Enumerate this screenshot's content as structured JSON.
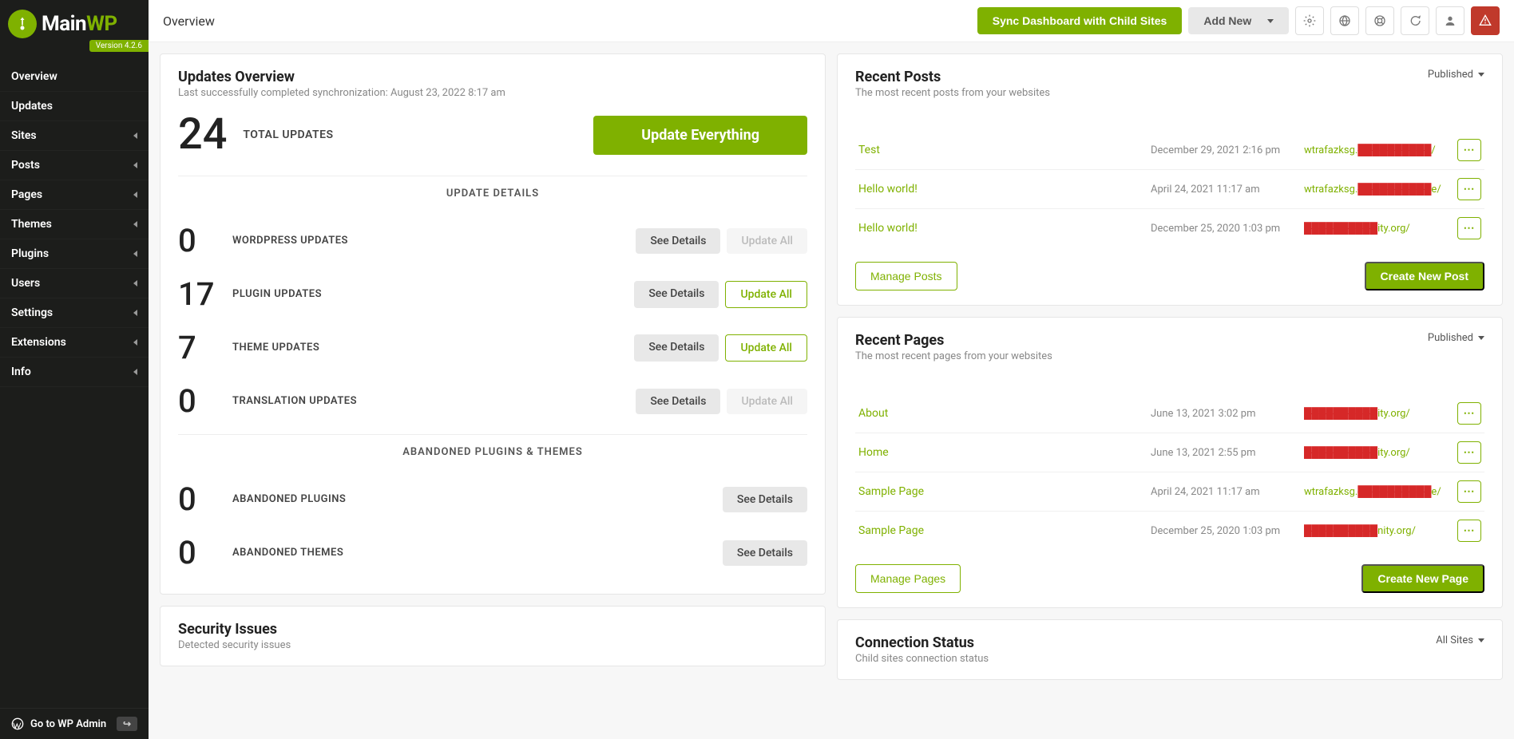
{
  "brand": {
    "name1": "Main",
    "name2": "WP",
    "version": "Version 4.2.6"
  },
  "sidebar": {
    "items": [
      {
        "label": "Overview",
        "caret": false
      },
      {
        "label": "Updates",
        "caret": false
      },
      {
        "label": "Sites",
        "caret": true
      },
      {
        "label": "Posts",
        "caret": true
      },
      {
        "label": "Pages",
        "caret": true
      },
      {
        "label": "Themes",
        "caret": true
      },
      {
        "label": "Plugins",
        "caret": true
      },
      {
        "label": "Users",
        "caret": true
      },
      {
        "label": "Settings",
        "caret": true
      },
      {
        "label": "Extensions",
        "caret": true
      },
      {
        "label": "Info",
        "caret": true
      }
    ],
    "footer": "Go to WP Admin"
  },
  "topbar": {
    "title": "Overview",
    "sync": "Sync Dashboard with Child Sites",
    "addnew": "Add New"
  },
  "updates": {
    "title": "Updates Overview",
    "sub": "Last successfully completed synchronization: August 23, 2022 8:17 am",
    "total_num": "24",
    "total_label": "TOTAL UPDATES",
    "update_everything": "Update Everything",
    "section1": "UPDATE DETAILS",
    "section2": "ABANDONED PLUGINS & THEMES",
    "see_details": "See Details",
    "update_all": "Update All",
    "rows": [
      {
        "num": "0",
        "label": "WORDPRESS UPDATES",
        "update_enabled": false
      },
      {
        "num": "17",
        "label": "PLUGIN UPDATES",
        "update_enabled": true
      },
      {
        "num": "7",
        "label": "THEME UPDATES",
        "update_enabled": true
      },
      {
        "num": "0",
        "label": "TRANSLATION UPDATES",
        "update_enabled": false
      }
    ],
    "abandoned": [
      {
        "num": "0",
        "label": "ABANDONED PLUGINS"
      },
      {
        "num": "0",
        "label": "ABANDONED THEMES"
      }
    ]
  },
  "security": {
    "title": "Security Issues",
    "sub": "Detected security issues"
  },
  "posts": {
    "title": "Recent Posts",
    "sub": "The most recent posts from your websites",
    "filter": "Published",
    "manage": "Manage Posts",
    "create": "Create New Post",
    "items": [
      {
        "title": "Test",
        "date": "December 29, 2021 2:16 pm",
        "site_pre": "wtrafazksg.",
        "site_red": "██████████",
        "site_suf": "/"
      },
      {
        "title": "Hello world!",
        "date": "April 24, 2021 11:17 am",
        "site_pre": "wtrafazksg.",
        "site_red": "██████████",
        "site_suf": "e/"
      },
      {
        "title": "Hello world!",
        "date": "December 25, 2020 1:03 pm",
        "site_pre": "",
        "site_red": "██████████",
        "site_suf": "ity.org/"
      }
    ]
  },
  "pages": {
    "title": "Recent Pages",
    "sub": "The most recent pages from your websites",
    "filter": "Published",
    "manage": "Manage Pages",
    "create": "Create New Page",
    "items": [
      {
        "title": "About",
        "date": "June 13, 2021 3:02 pm",
        "site_pre": "",
        "site_red": "██████████",
        "site_suf": "ity.org/"
      },
      {
        "title": "Home",
        "date": "June 13, 2021 2:55 pm",
        "site_pre": "",
        "site_red": "██████████",
        "site_suf": "ity.org/"
      },
      {
        "title": "Sample Page",
        "date": "April 24, 2021 11:17 am",
        "site_pre": "wtrafazksg.",
        "site_red": "██████████",
        "site_suf": "e/"
      },
      {
        "title": "Sample Page",
        "date": "December 25, 2020 1:03 pm",
        "site_pre": "",
        "site_red": "██████████",
        "site_suf": "nity.org/"
      }
    ]
  },
  "connection": {
    "title": "Connection Status",
    "sub": "Child sites connection status",
    "filter": "All Sites"
  }
}
